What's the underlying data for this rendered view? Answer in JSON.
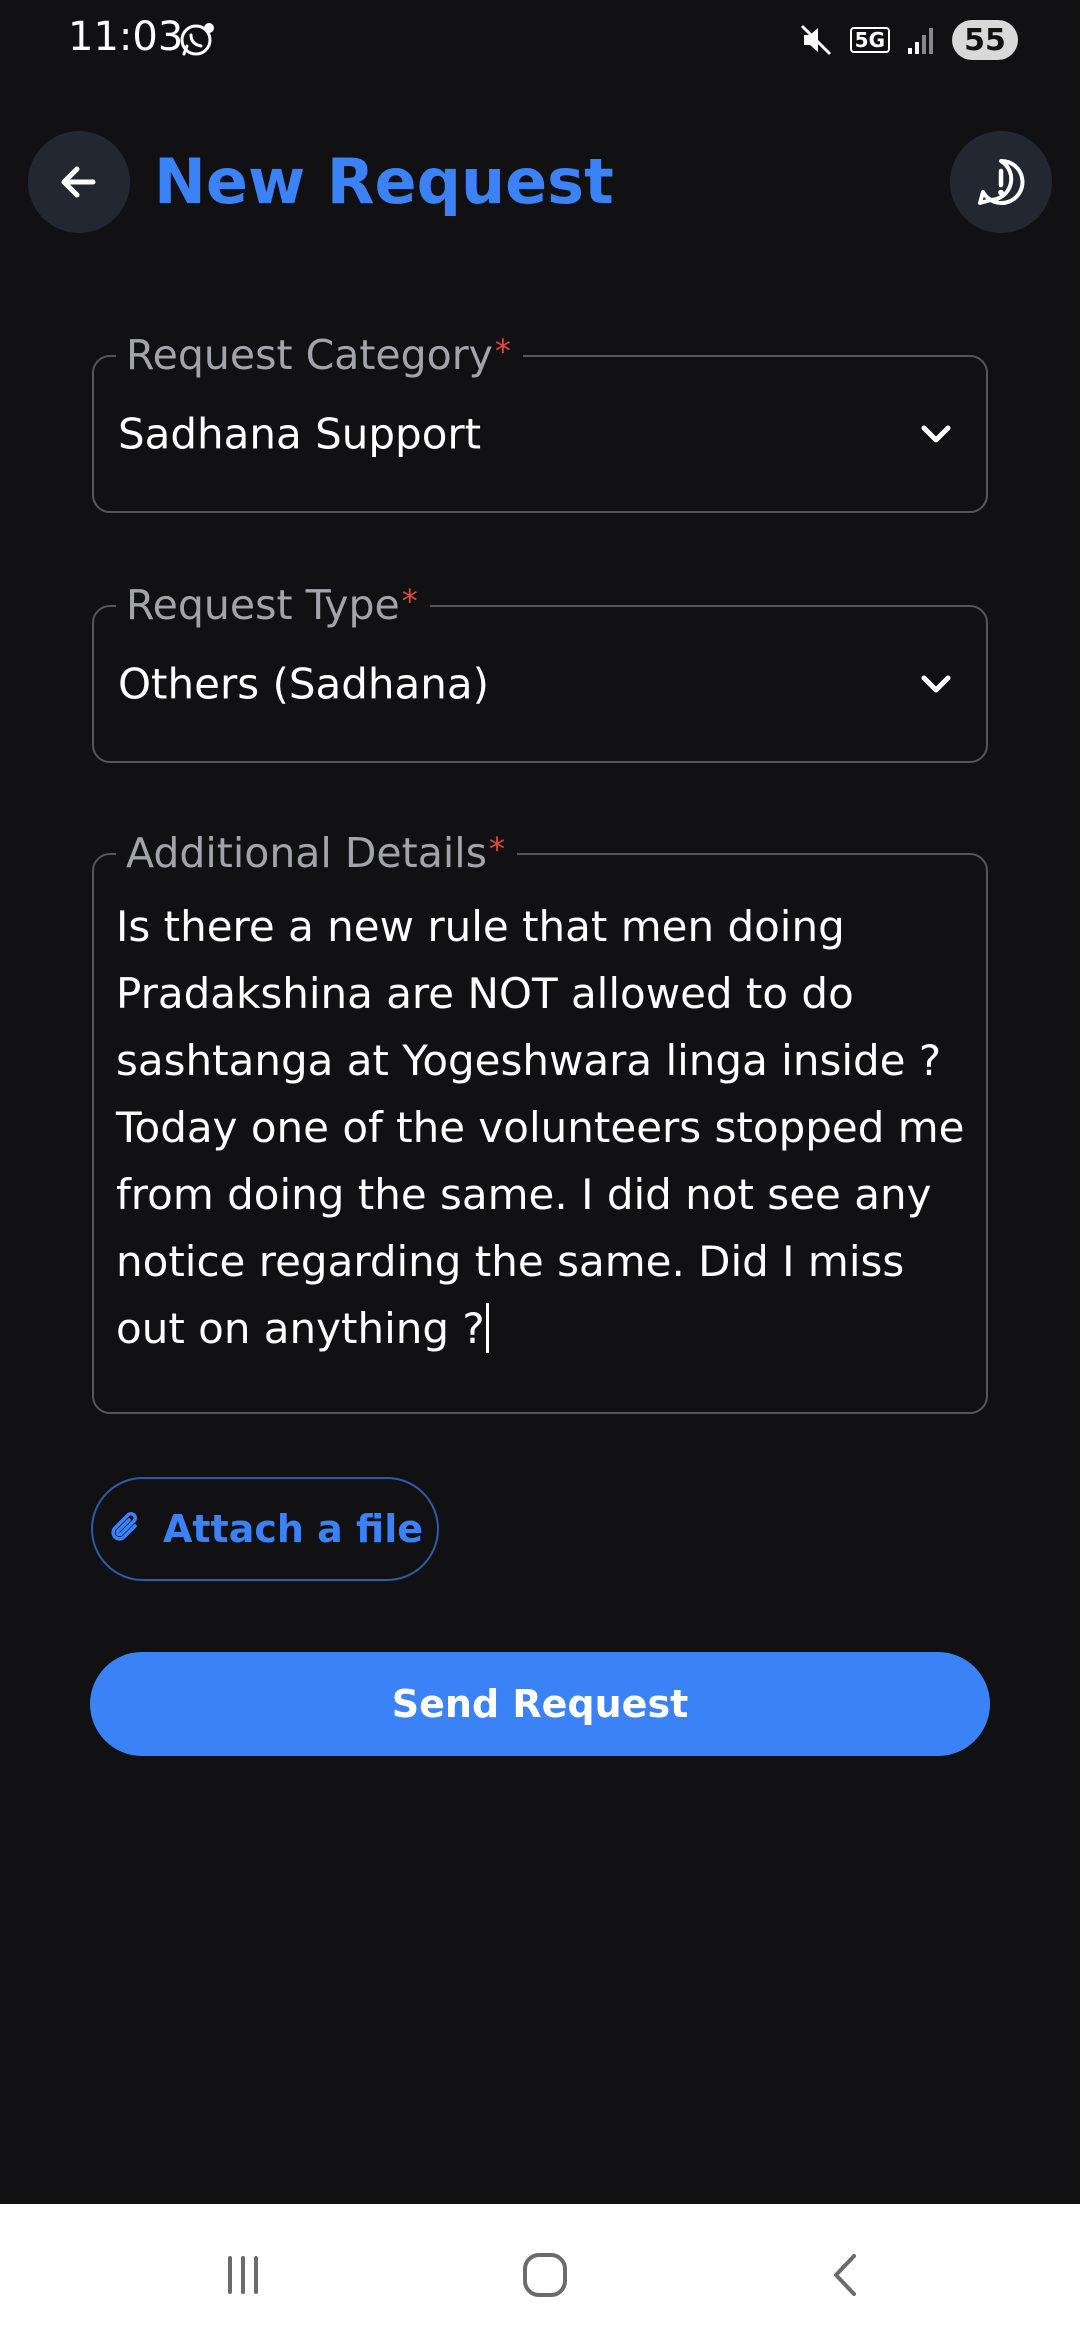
{
  "status_bar": {
    "time": "11:03",
    "network": "5G",
    "battery": "55",
    "icons": [
      "whatsapp-icon",
      "mute-icon",
      "signal-icon"
    ]
  },
  "header": {
    "title": "New Request",
    "back_icon": "arrow-left-icon",
    "help_icon": "alert-circle-icon"
  },
  "form": {
    "category": {
      "label": "Request Category",
      "required_mark": "*",
      "value": "Sadhana Support"
    },
    "type": {
      "label": "Request Type",
      "required_mark": "*",
      "value": "Others (Sadhana)"
    },
    "details": {
      "label": "Additional Details",
      "required_mark": "*",
      "value": "Is there a new rule that men doing Pradakshina are NOT allowed to do sashtanga at Yogeshwara linga inside ? Today one of the volunteers stopped me from doing the same. I did not see any notice regarding the same. Did I miss out on anything ?"
    }
  },
  "actions": {
    "attach_label": "Attach a file",
    "attach_icon": "paperclip-icon",
    "send_label": "Send Request"
  },
  "nav_bar": {
    "buttons": [
      "recent-apps-icon",
      "home-icon",
      "back-icon"
    ]
  },
  "colors": {
    "background": "#111113",
    "accent": "#3b82f6",
    "required": "#e0493f",
    "field_border": "#55575e",
    "label": "#a3a3ab"
  }
}
